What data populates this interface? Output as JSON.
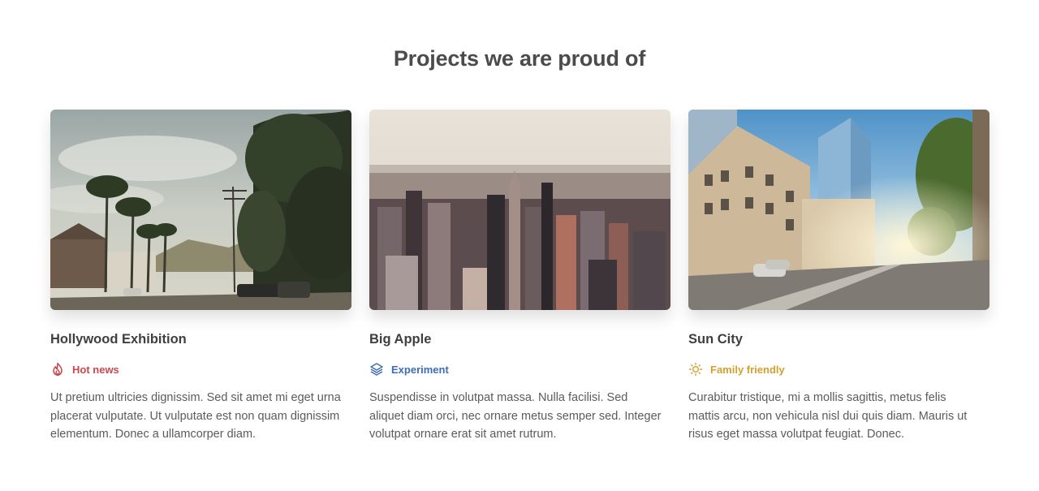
{
  "section": {
    "title": "Projects we are proud of"
  },
  "projects": [
    {
      "title": "Hollywood Exhibition",
      "tag": {
        "label": "Hot news",
        "icon": "flame-icon",
        "color": "#c9474f"
      },
      "description": "Ut pretium ultricies dignissim. Sed sit amet mi eget urna placerat vulputate. Ut vulputate est non quam dignissim elementum. Donec a ullamcorper diam."
    },
    {
      "title": "Big Apple",
      "tag": {
        "label": "Experiment",
        "icon": "layers-icon",
        "color": "#3c6db5"
      },
      "description": "Suspendisse in volutpat massa. Nulla facilisi. Sed aliquet diam orci, nec ornare metus semper sed. Integer volutpat ornare erat sit amet rutrum."
    },
    {
      "title": "Sun City",
      "tag": {
        "label": "Family friendly",
        "icon": "sun-icon",
        "color": "#d4a02f"
      },
      "description": "Curabitur tristique, mi a mollis sagittis, metus felis mattis arcu, non vehicula nisl dui quis diam. Mauris ut risus eget massa volutpat feugiat. Donec."
    }
  ]
}
